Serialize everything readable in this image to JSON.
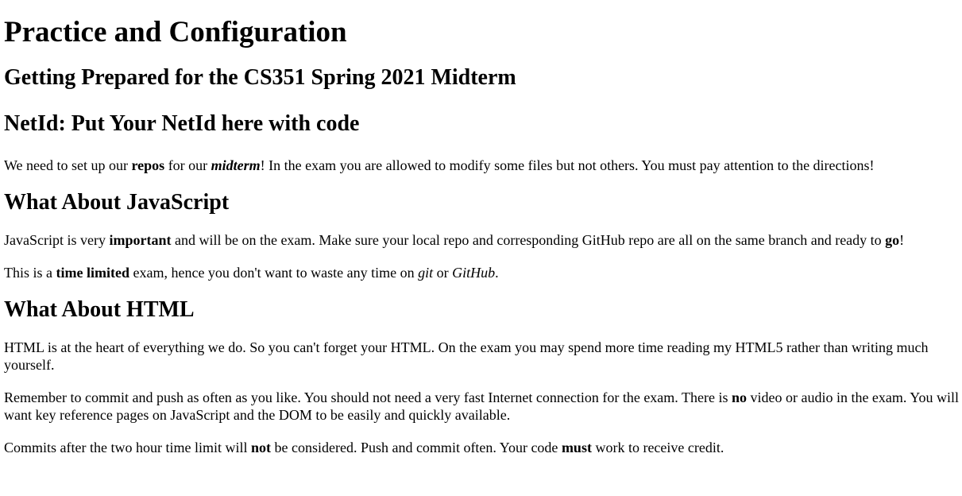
{
  "title": "Practice and Configuration",
  "subtitle": "Getting Prepared for the CS351 Spring 2021 Midterm",
  "netid_heading": "NetId: Put Your NetId here with code",
  "intro": {
    "t1": "We need to set up our ",
    "b1": "repos",
    "t2": " for our ",
    "bi1": "midterm",
    "t3": "! In the exam you are allowed to modify some files but not others. You must pay attention to the directions!"
  },
  "js_section": {
    "heading": "What About JavaScript",
    "p1": {
      "t1": "JavaScript is very ",
      "b1": "important",
      "t2": " and will be on the exam. Make sure your local repo and corresponding GitHub repo are all on the same branch and ready to ",
      "b2": "go",
      "t3": "!"
    },
    "p2": {
      "t1": "This is a ",
      "b1": "time limited",
      "t2": " exam, hence you don't want to waste any time on ",
      "i1": "git",
      "t3": " or ",
      "i2": "GitHub",
      "t4": "."
    }
  },
  "html_section": {
    "heading": "What About HTML",
    "p1": "HTML is at the heart of everything we do. So you can't forget your HTML. On the exam you may spend more time reading my HTML5 rather than writing much yourself.",
    "p2": {
      "t1": "Remember to commit and push as often as you like. You should not need a very fast Internet connection for the exam. There is ",
      "b1": "no",
      "t2": " video or audio in the exam. You will want key reference pages on JavaScript and the DOM to be easily and quickly available."
    },
    "p3": {
      "t1": "Commits after the two hour time limit will ",
      "b1": "not",
      "t2": " be considered. Push and commit often. Your code ",
      "b2": "must",
      "t3": " work to receive credit."
    }
  }
}
